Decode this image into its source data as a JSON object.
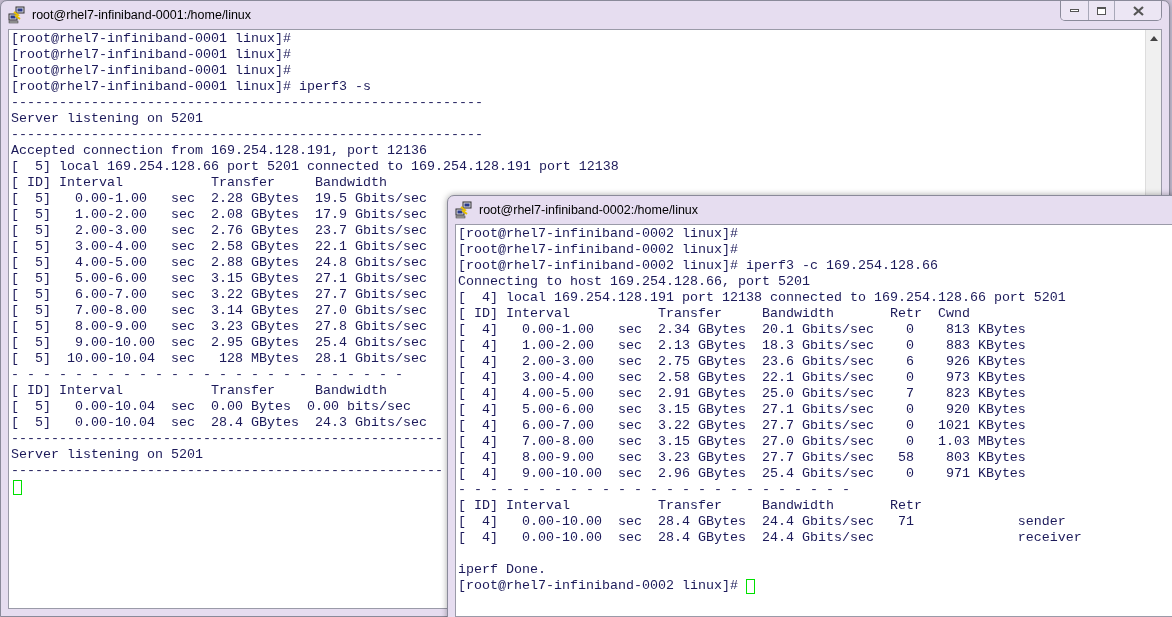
{
  "windows": [
    {
      "title": "root@rhel7-infiniband-0001:/home/linux",
      "buttons": true,
      "scrollbar": true,
      "lines": [
        {
          "kind": "text",
          "text": "[root@rhel7-infiniband-0001 linux]#"
        },
        {
          "kind": "text",
          "text": "[root@rhel7-infiniband-0001 linux]#"
        },
        {
          "kind": "text",
          "text": "[root@rhel7-infiniband-0001 linux]#"
        },
        {
          "kind": "text",
          "text": "[root@rhel7-infiniband-0001 linux]# iperf3 -s"
        },
        {
          "kind": "text",
          "text": "-----------------------------------------------------------"
        },
        {
          "kind": "text",
          "text": "Server listening on 5201"
        },
        {
          "kind": "text",
          "text": "-----------------------------------------------------------"
        },
        {
          "kind": "text",
          "text": "Accepted connection from 169.254.128.191, port 12136"
        },
        {
          "kind": "text",
          "text": "[  5] local 169.254.128.66 port 5201 connected to 169.254.128.191 port 12138"
        },
        {
          "kind": "text",
          "text": "[ ID] Interval           Transfer     Bandwidth"
        },
        {
          "kind": "text",
          "text": "[  5]   0.00-1.00   sec  2.28 GBytes  19.5 Gbits/sec"
        },
        {
          "kind": "text",
          "text": "[  5]   1.00-2.00   sec  2.08 GBytes  17.9 Gbits/sec"
        },
        {
          "kind": "text",
          "text": "[  5]   2.00-3.00   sec  2.76 GBytes  23.7 Gbits/sec"
        },
        {
          "kind": "text",
          "text": "[  5]   3.00-4.00   sec  2.58 GBytes  22.1 Gbits/sec"
        },
        {
          "kind": "text",
          "text": "[  5]   4.00-5.00   sec  2.88 GBytes  24.8 Gbits/sec"
        },
        {
          "kind": "text",
          "text": "[  5]   5.00-6.00   sec  3.15 GBytes  27.1 Gbits/sec"
        },
        {
          "kind": "text",
          "text": "[  5]   6.00-7.00   sec  3.22 GBytes  27.7 Gbits/sec"
        },
        {
          "kind": "text",
          "text": "[  5]   7.00-8.00   sec  3.14 GBytes  27.0 Gbits/sec"
        },
        {
          "kind": "text",
          "text": "[  5]   8.00-9.00   sec  3.23 GBytes  27.8 Gbits/sec"
        },
        {
          "kind": "text",
          "text": "[  5]   9.00-10.00  sec  2.95 GBytes  25.4 Gbits/sec"
        },
        {
          "kind": "text",
          "text": "[  5]  10.00-10.04  sec   128 MBytes  28.1 Gbits/sec"
        },
        {
          "kind": "text",
          "text": "- - - - - - - - - - - - - - - - - - - - - - - - -"
        },
        {
          "kind": "text",
          "text": "[ ID] Interval           Transfer     Bandwidth"
        },
        {
          "kind": "text",
          "text": "[  5]   0.00-10.04  sec  0.00 Bytes  0.00 bits/sec"
        },
        {
          "kind": "text",
          "text": "[  5]   0.00-10.04  sec  28.4 GBytes  24.3 Gbits/sec"
        },
        {
          "kind": "text",
          "text": "------------------------------------------------------"
        },
        {
          "kind": "text",
          "text": "Server listening on 5201"
        },
        {
          "kind": "text",
          "text": "------------------------------------------------------"
        },
        {
          "kind": "cursor"
        }
      ]
    },
    {
      "title": "root@rhel7-infiniband-0002:/home/linux",
      "lines": [
        {
          "kind": "text",
          "text": "[root@rhel7-infiniband-0002 linux]#"
        },
        {
          "kind": "text",
          "text": "[root@rhel7-infiniband-0002 linux]#"
        },
        {
          "kind": "text",
          "text": "[root@rhel7-infiniband-0002 linux]# iperf3 -c 169.254.128.66"
        },
        {
          "kind": "text",
          "text": "Connecting to host 169.254.128.66, port 5201"
        },
        {
          "kind": "text",
          "text": "[  4] local 169.254.128.191 port 12138 connected to 169.254.128.66 port 5201"
        },
        {
          "kind": "text",
          "text": "[ ID] Interval           Transfer     Bandwidth       Retr  Cwnd"
        },
        {
          "kind": "text",
          "text": "[  4]   0.00-1.00   sec  2.34 GBytes  20.1 Gbits/sec    0    813 KBytes"
        },
        {
          "kind": "text",
          "text": "[  4]   1.00-2.00   sec  2.13 GBytes  18.3 Gbits/sec    0    883 KBytes"
        },
        {
          "kind": "text",
          "text": "[  4]   2.00-3.00   sec  2.75 GBytes  23.6 Gbits/sec    6    926 KBytes"
        },
        {
          "kind": "text",
          "text": "[  4]   3.00-4.00   sec  2.58 GBytes  22.1 Gbits/sec    0    973 KBytes"
        },
        {
          "kind": "text",
          "text": "[  4]   4.00-5.00   sec  2.91 GBytes  25.0 Gbits/sec    7    823 KBytes"
        },
        {
          "kind": "text",
          "text": "[  4]   5.00-6.00   sec  3.15 GBytes  27.1 Gbits/sec    0    920 KBytes"
        },
        {
          "kind": "text",
          "text": "[  4]   6.00-7.00   sec  3.22 GBytes  27.7 Gbits/sec    0   1021 KBytes"
        },
        {
          "kind": "text",
          "text": "[  4]   7.00-8.00   sec  3.15 GBytes  27.0 Gbits/sec    0   1.03 MBytes"
        },
        {
          "kind": "text",
          "text": "[  4]   8.00-9.00   sec  3.23 GBytes  27.7 Gbits/sec   58    803 KBytes"
        },
        {
          "kind": "text",
          "text": "[  4]   9.00-10.00  sec  2.96 GBytes  25.4 Gbits/sec    0    971 KBytes"
        },
        {
          "kind": "text",
          "text": "- - - - - - - - - - - - - - - - - - - - - - - - -"
        },
        {
          "kind": "text",
          "text": "[ ID] Interval           Transfer     Bandwidth       Retr"
        },
        {
          "kind": "text",
          "text": "[  4]   0.00-10.00  sec  28.4 GBytes  24.4 Gbits/sec   71             sender"
        },
        {
          "kind": "text",
          "text": "[  4]   0.00-10.00  sec  28.4 GBytes  24.4 Gbits/sec                  receiver"
        },
        {
          "kind": "blank"
        },
        {
          "kind": "text",
          "text": "iperf Done."
        },
        {
          "kind": "prompt_cursor",
          "text": "[root@rhel7-infiniband-0002 linux]#"
        }
      ]
    }
  ]
}
